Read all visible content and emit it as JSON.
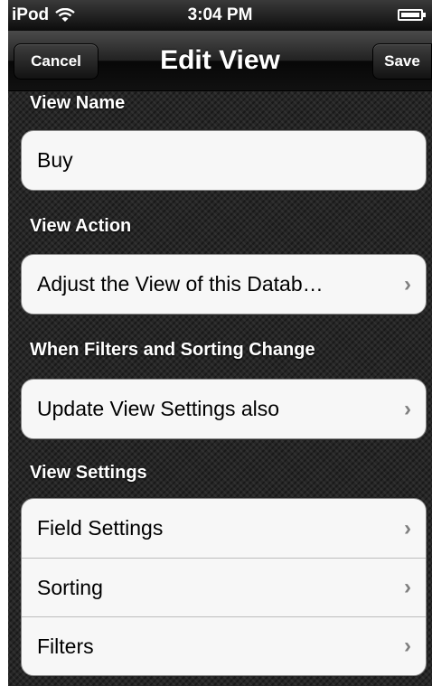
{
  "status": {
    "carrier": "iPod",
    "time": "3:04 PM",
    "wifi_icon": "wifi-icon",
    "battery_icon": "battery-icon"
  },
  "nav": {
    "cancel_label": "Cancel",
    "title": "Edit View",
    "save_label": "Save"
  },
  "sections": {
    "view_name": {
      "header": "View Name",
      "value": "Buy"
    },
    "view_action": {
      "header": "View Action",
      "value": "Adjust the View of this Datab…"
    },
    "filters_sorting": {
      "header": "When Filters and Sorting Change",
      "value": "Update View Settings also"
    },
    "view_settings": {
      "header": "View Settings",
      "items": [
        {
          "label": "Field Settings"
        },
        {
          "label": "Sorting"
        },
        {
          "label": "Filters"
        }
      ]
    }
  },
  "glyphs": {
    "chevron": "›"
  }
}
